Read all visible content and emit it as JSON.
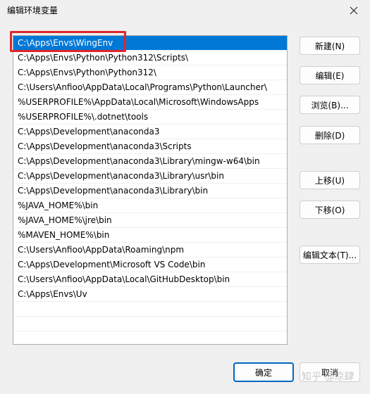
{
  "window": {
    "title": "编辑环境变量"
  },
  "list": {
    "items": [
      "C:\\Apps\\Envs\\WingEnv",
      "C:\\Apps\\Envs\\Python\\Python312\\Scripts\\",
      "C:\\Apps\\Envs\\Python\\Python312\\",
      "C:\\Users\\Anfioo\\AppData\\Local\\Programs\\Python\\Launcher\\",
      "%USERPROFILE%\\AppData\\Local\\Microsoft\\WindowsApps",
      "%USERPROFILE%\\.dotnet\\tools",
      "C:\\Apps\\Development\\anaconda3",
      "C:\\Apps\\Development\\anaconda3\\Scripts",
      "C:\\Apps\\Development\\anaconda3\\Library\\mingw-w64\\bin",
      "C:\\Apps\\Development\\anaconda3\\Library\\usr\\bin",
      "C:\\Apps\\Development\\anaconda3\\Library\\bin",
      "%JAVA_HOME%\\bin",
      "%JAVA_HOME%\\jre\\bin",
      "%MAVEN_HOME%\\bin",
      "C:\\Users\\Anfioo\\AppData\\Roaming\\npm",
      "C:\\Apps\\Development\\Microsoft VS Code\\bin",
      "C:\\Users\\Anfioo\\AppData\\Local\\GitHubDesktop\\bin",
      "C:\\Apps\\Envs\\Uv"
    ],
    "selected_index": 0
  },
  "buttons": {
    "new": "新建(N)",
    "edit": "编辑(E)",
    "browse": "浏览(B)...",
    "delete": "删除(D)",
    "move_up": "上移(U)",
    "move_down": "下移(O)",
    "edit_text": "编辑文本(T)...",
    "ok": "确定",
    "cancel": "取消"
  },
  "watermark": {
    "text": "知乎 @凉肆"
  },
  "colors": {
    "selection": "#0078d7",
    "highlight_box": "#e0262a",
    "ok_border": "#0067c0"
  },
  "icons": {
    "close": "close-icon"
  }
}
